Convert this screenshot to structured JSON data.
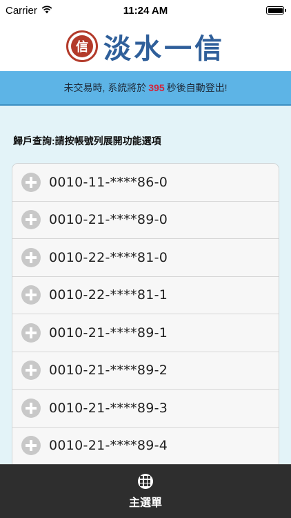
{
  "status_bar": {
    "carrier": "Carrier",
    "time": "11:24 AM"
  },
  "header": {
    "logo_seal_char": "信",
    "logo_text": "淡水一信"
  },
  "banner": {
    "prefix": "未交易時, 系統將於",
    "countdown": "395",
    "suffix": "秒後自動登出!"
  },
  "prompt": "歸戶查詢:請按帳號列展開功能選項",
  "accounts": [
    "0010-11-****86-0",
    "0010-21-****89-0",
    "0010-22-****81-0",
    "0010-22-****81-1",
    "0010-21-****89-1",
    "0010-21-****89-2",
    "0010-21-****89-3",
    "0010-21-****89-4"
  ],
  "tab_bar": {
    "main_menu_label": "主選單"
  },
  "colors": {
    "banner": "#5db4e6",
    "countdown": "#d4233a",
    "page_bg": "#e3f3f8",
    "tab_bar": "#2e2e2e",
    "logo_text": "#2f5f9a",
    "logo_seal": "#b33a2a"
  }
}
